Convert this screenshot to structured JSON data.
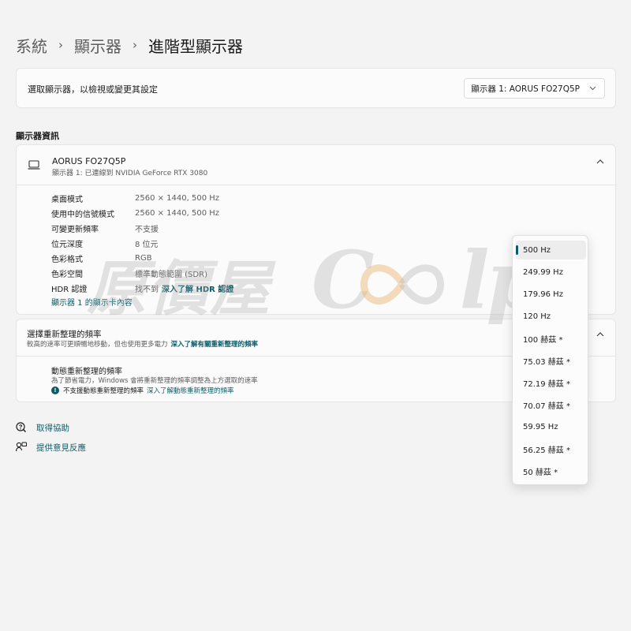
{
  "breadcrumb": [
    "系統",
    "顯示器",
    "進階型顯示器"
  ],
  "breadcrumb_separator": "›",
  "display_select": {
    "label": "選取顯示器，以檢視或變更其設定",
    "value": "顯示器 1: AORUS FO27Q5P"
  },
  "info": {
    "section_title": "顯示器資訊",
    "monitor_name": "AORUS FO27Q5P",
    "monitor_sub": "顯示器 1: 已連線到 NVIDIA GeForce RTX 3080",
    "rows": [
      {
        "key": "桌面模式",
        "value": "2560 × 1440, 500 Hz",
        "link": ""
      },
      {
        "key": "使用中的信號模式",
        "value": "2560 × 1440, 500 Hz",
        "link": ""
      },
      {
        "key": "可變更新頻率",
        "value": "不支援",
        "link": ""
      },
      {
        "key": "位元深度",
        "value": "8 位元",
        "link": ""
      },
      {
        "key": "色彩格式",
        "value": "RGB",
        "link": ""
      },
      {
        "key": "色彩空間",
        "value": "標準動態範圍 (SDR)",
        "link": ""
      },
      {
        "key": "HDR 認證",
        "value": "找不到",
        "link": "深入了解 HDR 認證"
      }
    ],
    "adapter_link": "顯示器 1 的顯示卡內容"
  },
  "refresh": {
    "title": "選擇重新整理的頻率",
    "desc": "較高的速率可更順暢地移動，但也使用更多電力",
    "desc_link": "深入了解有關重新整理的頻率",
    "dynamic_title": "動態重新整理的頻率",
    "dynamic_desc": "為了節省電力，Windows 會將重新整理的頻率調整為上方選取的速率",
    "dynamic_note": "不支援動態重新整理的頻率",
    "dynamic_note_link": "深入了解動態重新整理的頻率"
  },
  "footer": {
    "help": "取得協助",
    "feedback": "提供意見反應"
  },
  "refresh_menu": {
    "options": [
      "500 Hz",
      "249.99 Hz",
      "179.96 Hz",
      "120 Hz",
      "100 赫茲 *",
      "75.03 赫茲 *",
      "72.19 赫茲 *",
      "70.07 赫茲 *",
      "59.95 Hz",
      "56.25 赫茲 *",
      "50 赫茲 *"
    ],
    "selected_index": 0
  },
  "watermark": {
    "cjk": "原價屋",
    "latin_left": "C",
    "latin_right": "lpc"
  },
  "colors": {
    "accent": "#0c5a68",
    "watermark_loop_left": "#e8b26a",
    "watermark_loop_right": "#b8b8b8"
  },
  "icons": [
    "chevron-right-icon",
    "chevron-down-icon",
    "laptop-icon",
    "chevron-up-icon",
    "info-icon",
    "help-icon",
    "feedback-icon"
  ]
}
